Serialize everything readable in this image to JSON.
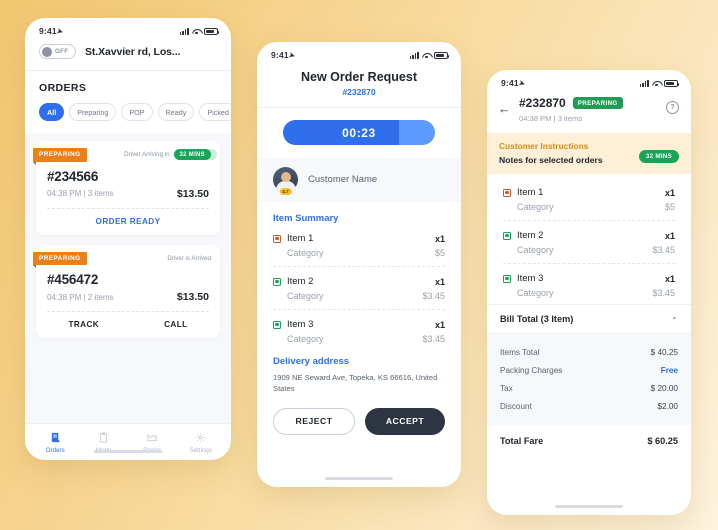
{
  "status_bar": {
    "time": "9:41"
  },
  "phone1": {
    "toggle": {
      "label": "OFF",
      "state": "off"
    },
    "address": "St.Xavvier rd, Los...",
    "section_title": "ORDERS",
    "chips": [
      {
        "label": "All",
        "active": true
      },
      {
        "label": "Preparing",
        "active": false
      },
      {
        "label": "POP",
        "active": false
      },
      {
        "label": "Ready",
        "active": false
      },
      {
        "label": "Picked",
        "active": false
      }
    ],
    "orders": [
      {
        "status": "PREPARING",
        "driver_text": "Driver Arriving in",
        "driver_pill": "32 MINS",
        "number": "#234566",
        "meta": "04:38 PM | 3 items",
        "price": "$13.50",
        "actions": [
          "ORDER READY"
        ]
      },
      {
        "status": "PREPARING",
        "driver_text": "Driver is Arrived",
        "driver_pill": "",
        "number": "#456472",
        "meta": "04:38 PM | 2 items",
        "price": "$13.50",
        "actions": [
          "TRACK",
          "CALL"
        ]
      }
    ],
    "tabs": [
      {
        "label": "Orders",
        "icon": "orders-icon",
        "active": true
      },
      {
        "label": "Menu",
        "icon": "menu-icon",
        "active": false
      },
      {
        "label": "Statics",
        "icon": "statics-icon",
        "active": false
      },
      {
        "label": "Settings",
        "icon": "settings-icon",
        "active": false
      }
    ]
  },
  "phone2": {
    "title": "New Order Request",
    "order_id": "#232870",
    "timer": "00:23",
    "timer_progress": 76,
    "customer": {
      "name": "Customer Name",
      "rating": "4.7"
    },
    "item_summary_title": "Item Summary",
    "items": [
      {
        "name": "Item 1",
        "category": "Category",
        "qty": "x1",
        "price": "$5",
        "veg": false
      },
      {
        "name": "Item 2",
        "category": "Category",
        "qty": "x1",
        "price": "$3.45",
        "veg": true
      },
      {
        "name": "Item 3",
        "category": "Category",
        "qty": "x1",
        "price": "$3.45",
        "veg": true
      }
    ],
    "address_title": "Delivery address",
    "address": "1909 NE Seward Ave, Topeka, KS 66616, United States",
    "reject_label": "REJECT",
    "accept_label": "ACCEPT"
  },
  "phone3": {
    "order_id": "#232870",
    "status_badge": "PREPARING",
    "meta": "04:38 PM | 3 items",
    "help_icon": "?",
    "notice": {
      "title": "Customer Instructions",
      "subtitle": "Notes for selected orders",
      "pill": "32 MINS"
    },
    "items": [
      {
        "name": "Item 1",
        "category": "Category",
        "qty": "x1",
        "price": "$5",
        "veg": false
      },
      {
        "name": "Item 2",
        "category": "Category",
        "qty": "x1",
        "price": "$3.45",
        "veg": true
      },
      {
        "name": "Item 3",
        "category": "Category",
        "qty": "x1",
        "price": "$3.45",
        "veg": true
      }
    ],
    "bill": {
      "title": "Bill Total (3 Item)",
      "rows": [
        {
          "label": "Items Total",
          "value": "$ 40.25",
          "free": false
        },
        {
          "label": "Packing Charges",
          "value": "Free",
          "free": true
        },
        {
          "label": "Tax",
          "value": "$ 20.00",
          "free": false
        },
        {
          "label": "Discount",
          "value": "$2.00",
          "free": false
        }
      ],
      "total_label": "Total Fare",
      "total_value": "$ 60.25"
    }
  },
  "colors": {
    "accent_blue": "#2f6fed",
    "status_orange": "#e8801c",
    "green": "#18a558",
    "amber_bg": "#fdf0d6"
  }
}
